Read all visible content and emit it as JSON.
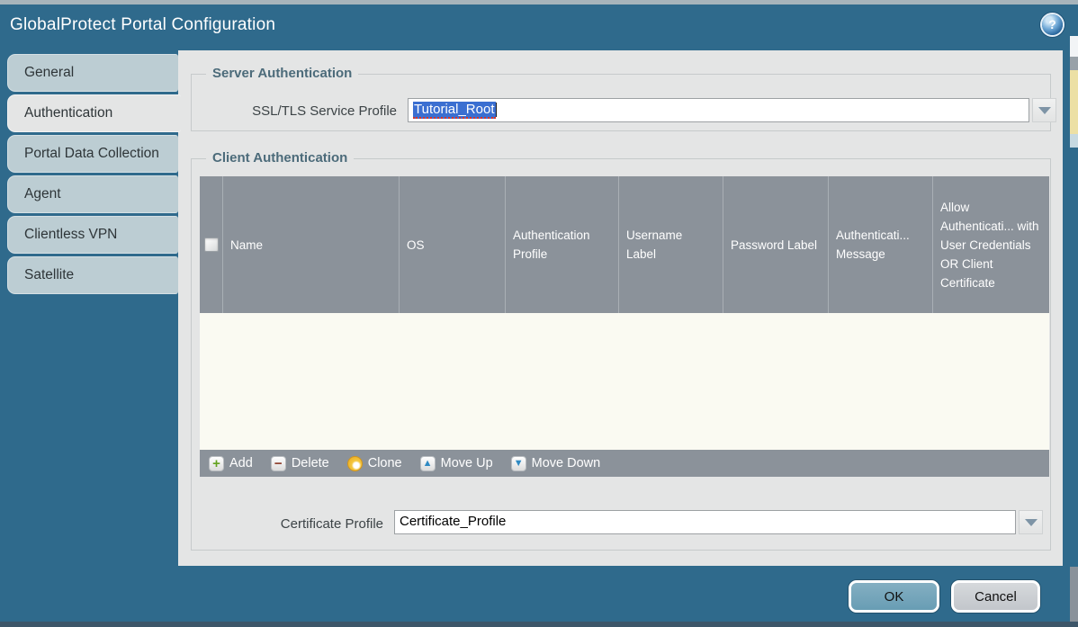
{
  "window": {
    "title": "GlobalProtect Portal Configuration",
    "help_icon_glyph": "?"
  },
  "sidebar": {
    "selected": "Authentication",
    "items": [
      {
        "label": "General",
        "selected": false
      },
      {
        "label": "Authentication",
        "selected": true
      },
      {
        "label": "Portal Data Collection",
        "selected": false
      },
      {
        "label": "Agent",
        "selected": false
      },
      {
        "label": "Clientless VPN",
        "selected": false
      },
      {
        "label": "Satellite",
        "selected": false
      }
    ]
  },
  "server_auth": {
    "legend": "Server Authentication",
    "ssl_tls_label": "SSL/TLS Service Profile",
    "ssl_tls_value": "Tutorial_Root",
    "value_selected": true
  },
  "client_auth": {
    "legend": "Client Authentication",
    "table": {
      "columns": [
        "Name",
        "OS",
        "Authentication Profile",
        "Username Label",
        "Password Label",
        "Authenticati... Message",
        "Allow Authenticati... with User Credentials OR Client Certificate"
      ],
      "rows": []
    },
    "toolbar": {
      "add": "Add",
      "delete": "Delete",
      "clone": "Clone",
      "move_up": "Move Up",
      "move_down": "Move Down"
    },
    "certificate_label": "Certificate Profile",
    "certificate_value": "Certificate_Profile"
  },
  "footer": {
    "ok": "OK",
    "cancel": "Cancel"
  },
  "colors": {
    "titlebar": "#2F6A8C",
    "panel": "#E4E5E5",
    "tab": "#BCCDD3",
    "tab_selected": "#E4E5E5",
    "table_header": "#8B929A",
    "table_body": "#FAFAF2",
    "selection_blue": "#3B6FD1",
    "ok_button": "#6FA3BC",
    "cancel_button": "#C9CDD2"
  }
}
